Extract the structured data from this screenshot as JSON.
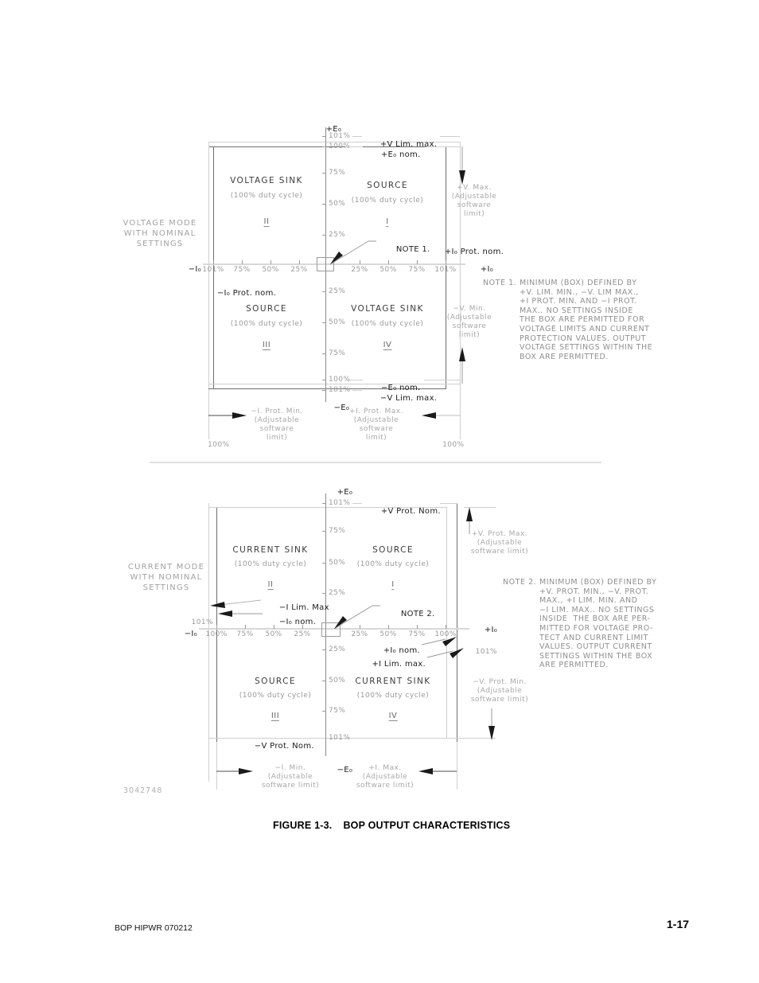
{
  "figure": {
    "caption_number": "FIGURE 1-3.",
    "caption_title": "BOP OUTPUT CHARACTERISTICS",
    "drawing_number": "3042748"
  },
  "footer": {
    "left": "BOP HIPWR 070212",
    "page": "1-17"
  },
  "chart_data": {
    "type": "scatter",
    "title": "BOP OUTPUT CHARACTERISTICS",
    "panels": [
      {
        "id": "voltage-mode",
        "mode_label": "VOLTAGE MODE\nWITH NOMINAL\nSETTINGS",
        "y_axis_top": "+E₀",
        "y_axis_bottom": "−E₀",
        "x_axis_left": "−I₀",
        "x_axis_right": "+I₀",
        "y_ticks_up": [
          "101%",
          "100%",
          "75%",
          "50%",
          "25%"
        ],
        "y_ticks_down": [
          "25%",
          "50%",
          "75%",
          "100%",
          "101%"
        ],
        "x_ticks_left": [
          "101%",
          "75%",
          "50%",
          "25%"
        ],
        "x_ticks_right": [
          "25%",
          "50%",
          "75%",
          "101%"
        ],
        "quadrants": [
          {
            "num": "I",
            "name": "SOURCE",
            "duty": "(100% duty cycle)"
          },
          {
            "num": "II",
            "name": "VOLTAGE SINK",
            "duty": "(100% duty cycle)"
          },
          {
            "num": "III",
            "name": "SOURCE",
            "duty": "(100% duty cycle)"
          },
          {
            "num": "IV",
            "name": "VOLTAGE SINK",
            "duty": "(100% duty cycle)"
          }
        ],
        "callouts": {
          "top_limit": "+V Lim. max.",
          "top_nominal": "+E₀ nom.",
          "bottom_nominal": "−E₀ nom.",
          "bottom_limit": "−V Lim. max.",
          "right_prot_nom": "+I₀ Prot. nom.",
          "left_prot_nom": "−I₀ Prot. nom.",
          "note_ref": "NOTE 1.",
          "v_max": "+V. Max.\n(Adjustable\nsoftware\nlimit)",
          "v_min": "−V. Min.\n(Adjustable\nsoftware\nlimit)",
          "i_prot_min": "−I. Prot. Min.\n(Adjustable\nsoftware\nlimit)",
          "i_prot_max": "+I. Prot. Max.\n(Adjustable\nsoftware\nlimit)",
          "bottom_left_pct": "100%",
          "bottom_right_pct": "100%"
        },
        "note": {
          "label": "NOTE 1.",
          "text": "MINIMUM (BOX) DEFINED BY\n+V. LIM. MIN., −V. LIM MAX.,\n+I PROT. MIN. AND −I PROT.\nMAX.. NO SETTINGS INSIDE\nTHE BOX ARE PERMITTED FOR\nVOLTAGE LIMITS AND CURRENT\nPROTECTION VALUES. OUTPUT\nVOLTAGE SETTINGS WITHIN THE\nBOX ARE PERMITTED."
        }
      },
      {
        "id": "current-mode",
        "mode_label": "CURRENT MODE\nWITH NOMINAL\nSETTINGS",
        "y_axis_top": "+E₀",
        "y_axis_bottom": "−E₀",
        "x_axis_left": "−I₀",
        "x_axis_right": "+I₀",
        "y_ticks_up": [
          "101%",
          "75%",
          "50%",
          "25%"
        ],
        "y_ticks_down": [
          "25%",
          "50%",
          "75%",
          "101%"
        ],
        "x_ticks_left": [
          "100%",
          "75%",
          "50%",
          "25%"
        ],
        "x_ticks_right": [
          "25%",
          "50%",
          "75%",
          "100%"
        ],
        "quadrants": [
          {
            "num": "I",
            "name": "SOURCE",
            "duty": "(100% duty cycle)"
          },
          {
            "num": "II",
            "name": "CURRENT SINK",
            "duty": "(100% duty cycle)"
          },
          {
            "num": "III",
            "name": "SOURCE",
            "duty": "(100% duty cycle)"
          },
          {
            "num": "IV",
            "name": "CURRENT SINK",
            "duty": "(100% duty cycle)"
          }
        ],
        "callouts": {
          "top_prot_nom": "+V Prot. Nom.",
          "bottom_prot_nom": "−V Prot. Nom.",
          "left_lim_max": "−I Lim. Max",
          "left_nom": "−I₀ nom.",
          "left_pct_101": "101%",
          "right_nom": "+I₀ nom.",
          "right_lim_max": "+I Lim. max.",
          "right_pct_101": "101%",
          "note_ref": "NOTE 2.",
          "v_prot_max": "+V. Prot. Max.\n(Adjustable\nsoftware limit)",
          "v_prot_min": "−V. Prot. Min.\n(Adjustable\nsoftware limit)",
          "i_min": "−I. Min.\n(Adjustable\nsoftware limit)",
          "i_max": "+I. Max.\n(Adjustable\nsoftware limit)"
        },
        "note": {
          "label": "NOTE 2.",
          "text": "MINIMUM (BOX) DEFINED BY\n+V. PROT. MIN., −V. PROT.\nMAX., +I LIM. MIN. AND\n−I LIM. MAX.. NO SETTINGS\nINSIDE  THE BOX ARE PER-\nMITTED FOR VOLTAGE PRO-\nTECT AND CURRENT LIMIT\nVALUES. OUTPUT CURRENT\nSETTINGS WITHIN THE BOX\nARE PERMITTED."
        }
      }
    ]
  },
  "colors": {
    "line_light": "#cfcfcf",
    "line_dark": "#6e6e6e",
    "text_gray": "#8a8a8a",
    "text_dark": "#1a1a1a"
  }
}
